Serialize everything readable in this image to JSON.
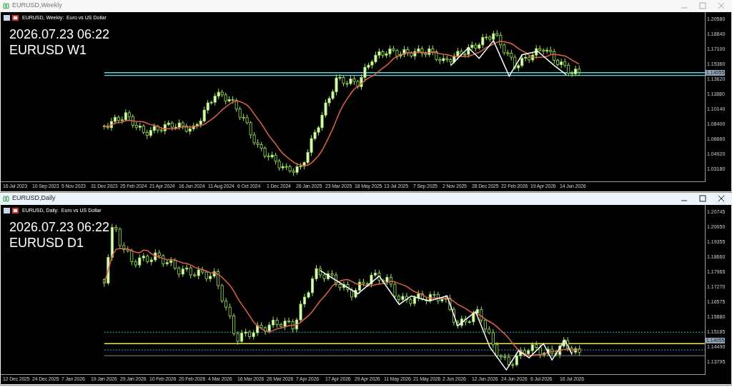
{
  "windows": [
    {
      "title": "EURUSD,Weekly",
      "active": false,
      "subtitle": "EURUSD, Weekly:  Euro vs US Dollar",
      "overlay_time": "2026.07.23 06:22",
      "overlay_symbol": "EURUSD W1",
      "current_price": "1.14055",
      "price_labels": [
        "1.20580",
        "1.18840",
        "1.17100",
        "1.15360",
        "1.13620",
        "1.11880",
        "1.10140",
        "1.08400",
        "1.06660",
        "1.04920",
        "1.03180"
      ],
      "time_labels": [
        "16 Jul 2023",
        "10 Sep 2023",
        "5 Nov 2023",
        "31 Dec 2023",
        "25 Feb 2024",
        "21 Apr 2024",
        "16 Jun 2024",
        "11 Aug 2024",
        "6 Oct 2024",
        "1 Dec 2024",
        "26 Jan 2025",
        "23 Mar 2025",
        "18 May 2025",
        "13 Jul 2025",
        "7 Sep 2025",
        "2 Nov 2025",
        "28 Dec 2025",
        "22 Feb 2026",
        "19 Apr 2026",
        "14 Jun 2026"
      ]
    },
    {
      "title": "EURUSD,Daily",
      "active": true,
      "subtitle": "EURUSD, Daily:  Euro vs US Dollar",
      "overlay_time": "2026.07.23 06:22",
      "overlay_symbol": "EURUSD D1",
      "current_price": "1.14055",
      "price_labels": [
        "1.20745",
        "1.20050",
        "1.19355",
        "1.18660",
        "1.17965",
        "1.17270",
        "1.16575",
        "1.15880",
        "1.15185",
        "1.14490",
        "1.13795"
      ],
      "time_labels": [
        "12 Dec 2025",
        "24 Dec 2025",
        "7 Jan 2026",
        "19 Jan 2026",
        "29 Jan 2026",
        "10 Feb 2026",
        "20 Feb 2026",
        "4 Mar 2026",
        "16 Mar 2026",
        "26 Mar 2026",
        "7 Apr 2026",
        "17 Apr 2026",
        "29 Apr 2026",
        "11 May 2026",
        "21 May 2026",
        "2 Jun 2026",
        "12 Jun 2026",
        "24 Jun 2026",
        "6 Jul 2026",
        "16 Jul 2026"
      ]
    }
  ]
}
